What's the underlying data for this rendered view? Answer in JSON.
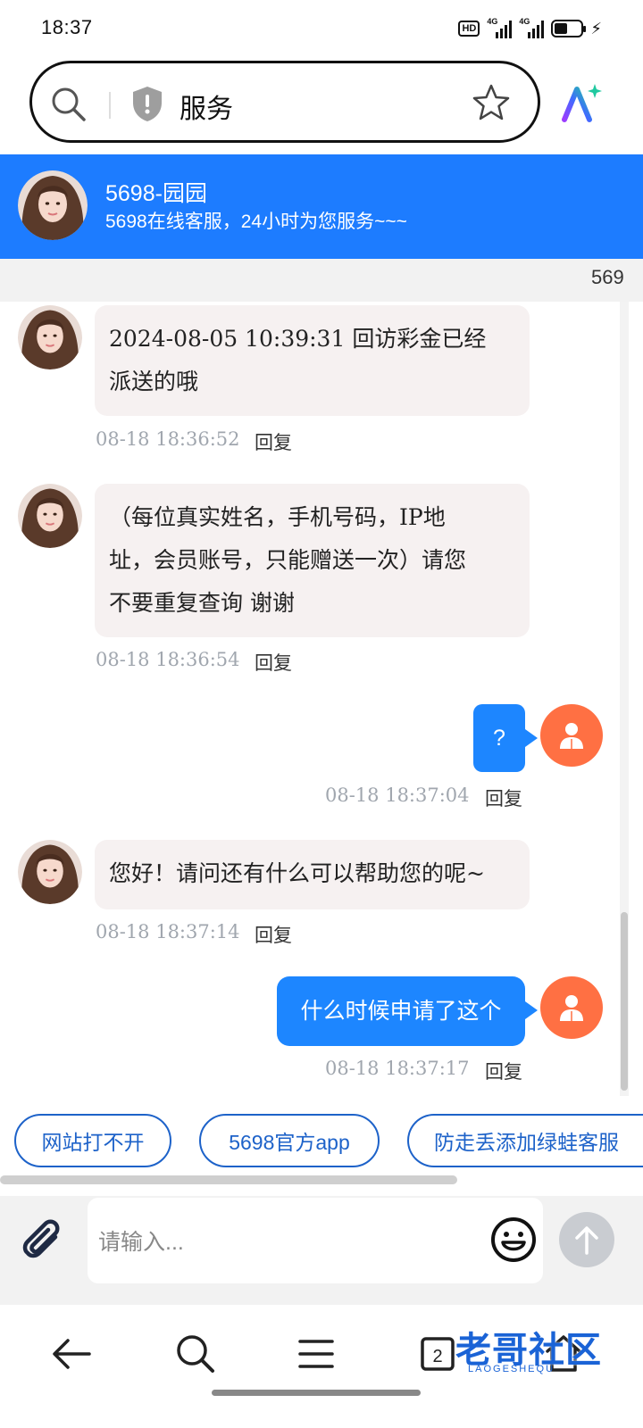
{
  "status_bar": {
    "time": "18:37",
    "hd": "HD",
    "net1": "4G",
    "net2": "4G"
  },
  "browser": {
    "url": "服务",
    "tab_count": "2"
  },
  "chat_header": {
    "title": "5698-园园",
    "subtitle": "5698在线客服，24小时为您服务~~~"
  },
  "notice": "569",
  "messages": [
    {
      "from": "agent",
      "text": "2024-08-05 10:39:31 回访彩金已经派送的哦",
      "line1": "2024-08-05 10:39:31  回访彩金已经",
      "line2": "派送的哦",
      "time": "08-18 18:36:52",
      "reply": "回复"
    },
    {
      "from": "agent",
      "line1": "（每位真实姓名，手机号码，IP地",
      "line2": "址，会员账号，只能赠送一次）请您",
      "line3": "不要重复查询 谢谢",
      "time": "08-18 18:36:54",
      "reply": "回复"
    },
    {
      "from": "user",
      "text": "?",
      "time": "08-18 18:37:04",
      "reply": "回复"
    },
    {
      "from": "agent",
      "text": "您好！请问还有什么可以帮助您的呢~",
      "time": "08-18 18:37:14",
      "reply": "回复"
    },
    {
      "from": "user",
      "text": "什么时候申请了这个",
      "time": "08-18 18:37:17",
      "reply": "回复"
    }
  ],
  "quick_replies": [
    "网站打不开",
    "5698官方app",
    "防走丢添加绿蛙客服"
  ],
  "input": {
    "placeholder": "请输入..."
  },
  "watermark": {
    "text": "老哥社区",
    "sub": "LAOGESHEQU"
  },
  "colors": {
    "accent": "#1d7cff",
    "user_avatar": "#ff7043",
    "quick_border": "#1d62c9"
  }
}
